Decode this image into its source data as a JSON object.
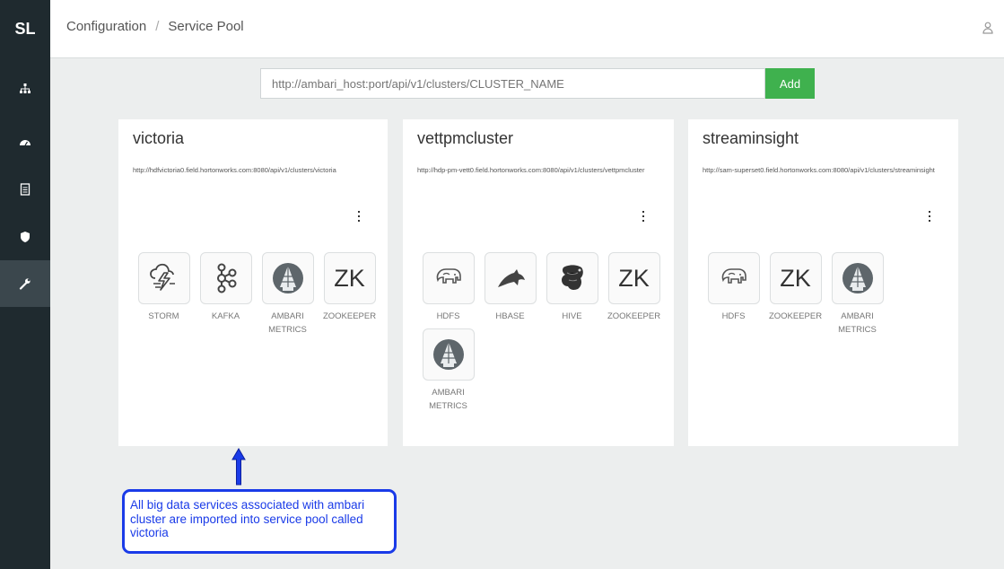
{
  "app": {
    "logo": "SL"
  },
  "header": {
    "crumb_1": "Configuration",
    "separator": "/",
    "crumb_2": "Service Pool"
  },
  "sidebar": {
    "items": [
      {
        "icon": "sitemap-icon"
      },
      {
        "icon": "dashboard-icon"
      },
      {
        "icon": "file-icon"
      },
      {
        "icon": "shield-icon"
      },
      {
        "icon": "wrench-icon",
        "active": true
      }
    ]
  },
  "url_bar": {
    "placeholder": "http://ambari_host:port/api/v1/clusters/CLUSTER_NAME",
    "add_label": "Add"
  },
  "clusters": [
    {
      "name": "victoria",
      "url": "http://hdfvictoria0.field.hortonworks.com:8080/api/v1/clusters/victoria",
      "services": [
        {
          "label": "STORM",
          "icon": "storm-icon"
        },
        {
          "label": "KAFKA",
          "icon": "kafka-icon"
        },
        {
          "label": "AMBARI METRICS",
          "icon": "ambari-metrics-icon"
        },
        {
          "label": "ZOOKEEPER",
          "icon": "zookeeper-icon",
          "glyph": "ZK"
        }
      ]
    },
    {
      "name": "vettpmcluster",
      "url": "http://hdp-pm-vett0.field.hortonworks.com:8080/api/v1/clusters/vettpmcluster",
      "services": [
        {
          "label": "HDFS",
          "icon": "hdfs-icon"
        },
        {
          "label": "HBASE",
          "icon": "hbase-icon"
        },
        {
          "label": "HIVE",
          "icon": "hive-icon"
        },
        {
          "label": "ZOOKEEPER",
          "icon": "zookeeper-icon",
          "glyph": "ZK"
        },
        {
          "label": "AMBARI METRICS",
          "icon": "ambari-metrics-icon"
        }
      ]
    },
    {
      "name": "streaminsight",
      "url": "http://sam-superset0.field.hortonworks.com:8080/api/v1/clusters/streaminsight",
      "services": [
        {
          "label": "HDFS",
          "icon": "hdfs-icon"
        },
        {
          "label": "ZOOKEEPER",
          "icon": "zookeeper-icon",
          "glyph": "ZK"
        },
        {
          "label": "AMBARI METRICS",
          "icon": "ambari-metrics-icon"
        }
      ]
    }
  ],
  "annotation": {
    "text": "All big data services associated with ambari cluster  are imported into service pool called victoria",
    "color": "#1a3be8"
  }
}
